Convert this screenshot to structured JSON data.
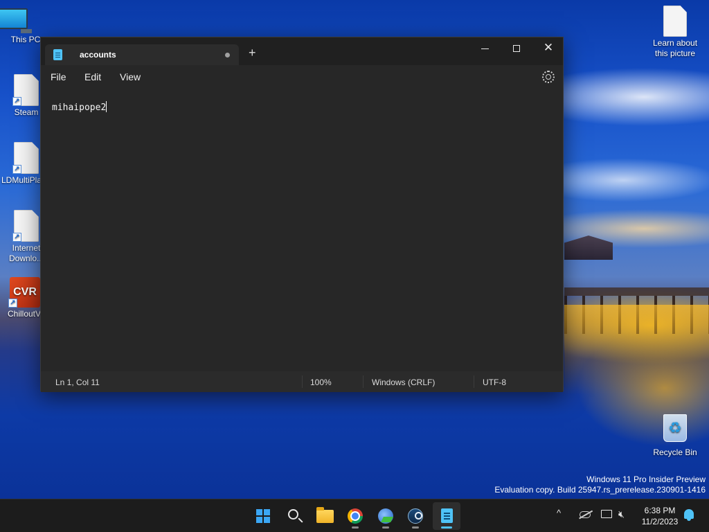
{
  "desktop": {
    "icons": [
      {
        "label": "This PC"
      },
      {
        "label": "Steam"
      },
      {
        "label": "LDMultiPla"
      },
      {
        "label": "Internet Downlo..."
      },
      {
        "label": "ChilloutV"
      },
      {
        "label": "Learn about this picture"
      },
      {
        "label": "Recycle Bin"
      }
    ],
    "chillout_logo_text": "CVR"
  },
  "notepad": {
    "tab_title": "accounts",
    "new_tab_symbol": "+",
    "menu": {
      "file": "File",
      "edit": "Edit",
      "view": "View"
    },
    "content": "mihaipope2",
    "status": {
      "position": "Ln 1, Col 11",
      "zoom": "100%",
      "line_ending": "Windows (CRLF)",
      "encoding": "UTF-8"
    },
    "accent_color": "#4fc3f7"
  },
  "watermark": {
    "line1": "Windows 11 Pro Insider Preview",
    "line2": "Evaluation copy. Build 25947.rs_prerelease.230901-1416"
  },
  "taskbar": {
    "apps": [
      "start",
      "search",
      "file-explorer",
      "chrome",
      "internet-download-manager",
      "steam",
      "notepad"
    ],
    "clock": {
      "time": "6:38 PM",
      "date": "11/2/2023"
    },
    "tray_chevron": "^"
  }
}
